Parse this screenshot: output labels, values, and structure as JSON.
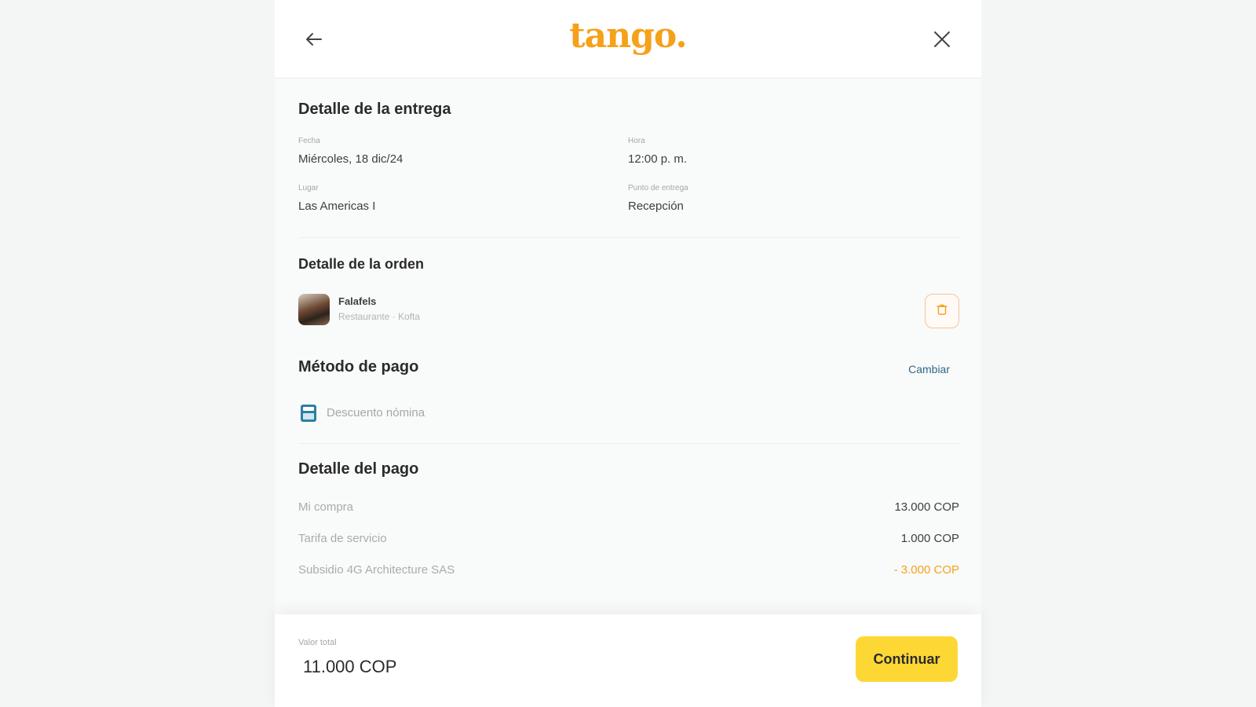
{
  "header": {
    "logo": "tango.",
    "back_icon": "arrow-left-icon",
    "close_icon": "close-icon"
  },
  "delivery": {
    "title": "Detalle de la entrega",
    "date_label": "Fecha",
    "date_value": "Miércoles, 18 dic/24",
    "time_label": "Hora",
    "time_value": "12:00 p. m.",
    "place_label": "Lugar",
    "place_value": "Las Americas I",
    "point_label": "Punto de entrega",
    "point_value": "Recepción"
  },
  "order": {
    "title": "Detalle de la orden",
    "item_name": "Falafels",
    "item_sub": "Restaurante · Kofta",
    "delete_icon": "trash-icon"
  },
  "payment_method": {
    "title": "Método de pago",
    "change_label": "Cambiar",
    "method_label": "Descuento nómina",
    "method_icon": "calculator-icon"
  },
  "payment_detail": {
    "title": "Detalle del pago",
    "rows": [
      {
        "label": "Mi compra",
        "value": "13.000 COP"
      },
      {
        "label": "Tarifa de servicio",
        "value": "1.000 COP"
      },
      {
        "label": "Subsidio 4G Architecture SAS",
        "value": "- 3.000 COP"
      }
    ]
  },
  "footer": {
    "total_label": "Valor total",
    "total_value": "11.000 COP",
    "continue_label": "Continuar"
  },
  "colors": {
    "brand": "#f5a11a",
    "button": "#fdd835",
    "link": "#2e6a86"
  }
}
